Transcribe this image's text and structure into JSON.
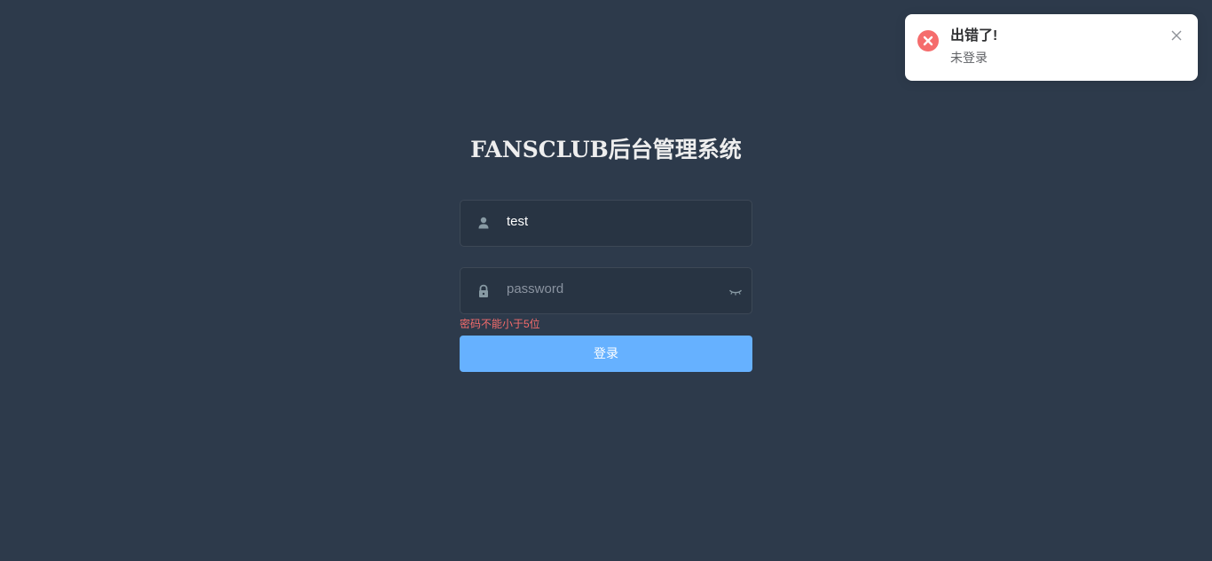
{
  "login": {
    "title": "FANSCLUB后台管理系统",
    "username": {
      "value": "test",
      "icon": "user-icon"
    },
    "password": {
      "placeholder": "password",
      "icon": "lock-icon",
      "toggle_icon": "eye-closed-icon",
      "error": "密码不能小于5位"
    },
    "submit_label": "登录"
  },
  "notification": {
    "title": "出错了!",
    "message": "未登录",
    "icon": "error-circle-icon",
    "close_icon": "close-icon"
  },
  "colors": {
    "background": "#2d3a4b",
    "input_background": "#283443",
    "button": "#66b1ff",
    "error": "#f56c6c"
  }
}
